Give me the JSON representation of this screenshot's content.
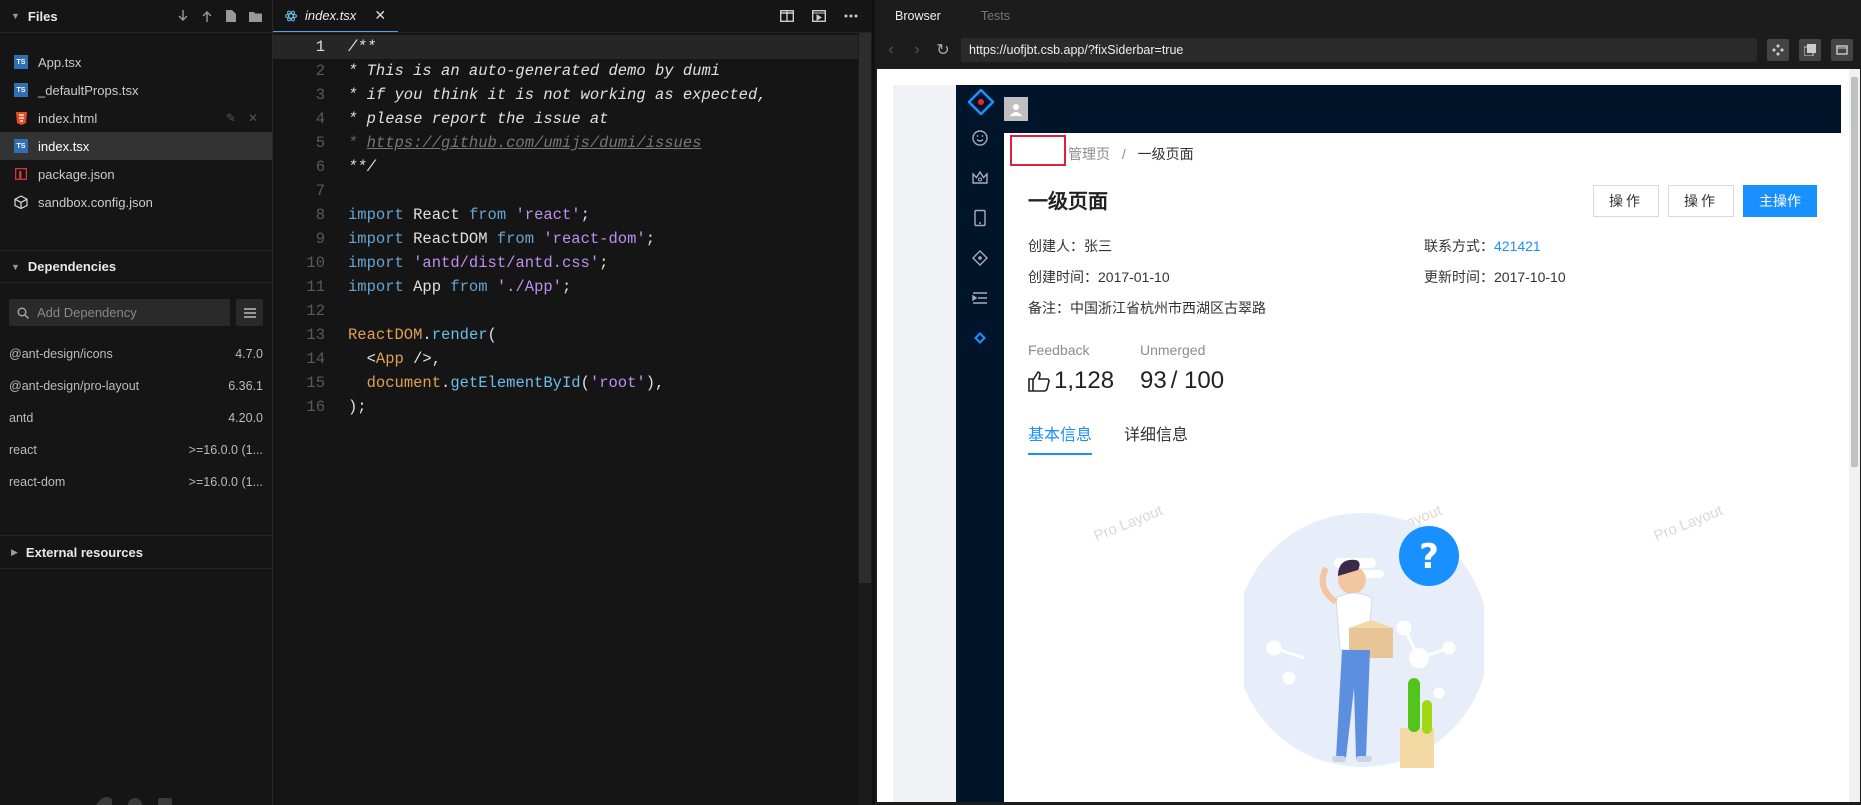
{
  "files": {
    "title": "Files",
    "items": [
      {
        "name": "App.tsx",
        "type": "tsx"
      },
      {
        "name": "_defaultProps.tsx",
        "type": "tsx"
      },
      {
        "name": "index.html",
        "type": "html"
      },
      {
        "name": "index.tsx",
        "type": "tsx"
      },
      {
        "name": "package.json",
        "type": "json"
      },
      {
        "name": "sandbox.config.json",
        "type": "config"
      }
    ]
  },
  "dependencies": {
    "title": "Dependencies",
    "search_placeholder": "Add Dependency",
    "items": [
      {
        "name": "@ant-design/icons",
        "version": "4.7.0"
      },
      {
        "name": "@ant-design/pro-layout",
        "version": "6.36.1"
      },
      {
        "name": "antd",
        "version": "4.20.0"
      },
      {
        "name": "react",
        "version": ">=16.0.0 (1..."
      },
      {
        "name": "react-dom",
        "version": ">=16.0.0 (1..."
      }
    ]
  },
  "external": {
    "title": "External resources"
  },
  "editor": {
    "tab_label": "index.tsx",
    "line_numbers": [
      "1",
      "2",
      "3",
      "4",
      "5",
      "6",
      "7",
      "8",
      "9",
      "10",
      "11",
      "12",
      "13",
      "14",
      "15",
      "16"
    ],
    "lines": [
      "/**",
      "* This is an auto-generated demo by dumi",
      "* if you think it is not working as expected,",
      "* please report the issue at",
      "https://github.com/umijs/dumi/issues",
      "**/",
      "",
      "import React from 'react';",
      "import ReactDOM from 'react-dom';",
      "import 'antd/dist/antd.css';",
      "import App from './App';",
      "",
      "ReactDOM.render(",
      "<App />,",
      "document.getElementById('root'),",
      ");"
    ]
  },
  "preview": {
    "tab_browser": "Browser",
    "tab_tests": "Tests",
    "url": "https://uofjbt.csb.app/?fixSiderbar=true",
    "breadcrumb_parent": "管理页",
    "breadcrumb_sep": "/",
    "breadcrumb_current": "一级页面",
    "page_title": "一级页面",
    "btn_action1": "操作",
    "btn_action2": "操作",
    "btn_primary": "主操作",
    "creator_label": "创建人：",
    "creator_value": "张三",
    "contact_label": "联系方式：",
    "contact_value": "421421",
    "created_label": "创建时间：",
    "created_value": "2017-01-10",
    "updated_label": "更新时间：",
    "updated_value": "2017-10-10",
    "note_label": "备注：",
    "note_value": "中国浙江省杭州市西湖区古翠路",
    "stat1_label": "Feedback",
    "stat1_value": "1,128",
    "stat2_label": "Unmerged",
    "stat2_value": "93",
    "stat2_total": "/ 100",
    "tab_basic": "基本信息",
    "tab_detail": "详细信息",
    "watermark": "Pro Layout"
  },
  "colors": {
    "primary": "#1890ff",
    "sider": "#001529",
    "highlight_box": "#e0203a"
  }
}
